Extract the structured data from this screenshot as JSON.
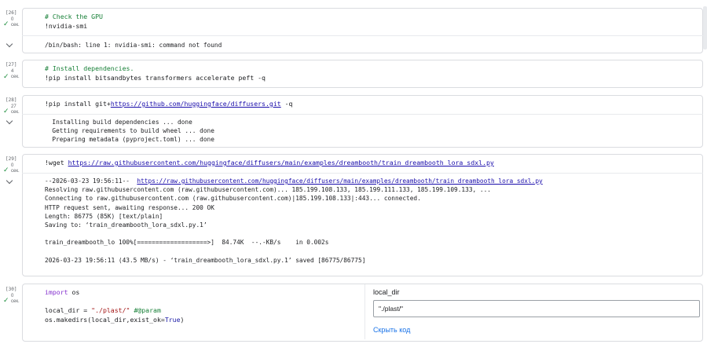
{
  "cells": [
    {
      "exec_count": "[26]",
      "duration": "0",
      "unit": "сек.",
      "code": [
        "# Check the GPU",
        "!nvidia-smi"
      ],
      "output": [
        "/bin/bash: line 1: nvidia-smi: command not found"
      ]
    },
    {
      "exec_count": "[27]",
      "duration": "4",
      "unit": "сек.",
      "code": [
        "# Install dependencies.",
        "!pip install bitsandbytes transformers accelerate peft -q"
      ]
    },
    {
      "exec_count": "[28]",
      "duration": "27",
      "unit": "сек.",
      "code_prefix": "!pip install git+",
      "code_link": "https://github.com/huggingface/diffusers.git",
      "code_suffix": " -q",
      "output": [
        "  Installing build dependencies ... done",
        "  Getting requirements to build wheel ... done",
        "  Preparing metadata (pyproject.toml) ... done"
      ]
    },
    {
      "exec_count": "[29]",
      "duration": "0",
      "unit": "сек.",
      "code_prefix": "!wget ",
      "code_link": "https://raw.githubusercontent.com/huggingface/diffusers/main/examples/dreambooth/train_dreambooth_lora_sdxl.py",
      "output_first_prefix": "--2026-03-23 19:56:11--  ",
      "output_first_link": "https://raw.githubusercontent.com/huggingface/diffusers/main/examples/dreambooth/train_dreambooth_lora_sdxl.py",
      "output": [
        "Resolving raw.githubusercontent.com (raw.githubusercontent.com)... 185.199.108.133, 185.199.111.133, 185.199.109.133, ...",
        "Connecting to raw.githubusercontent.com (raw.githubusercontent.com)|185.199.108.133|:443... connected.",
        "HTTP request sent, awaiting response... 200 OK",
        "Length: 86775 (85K) [text/plain]",
        "Saving to: ‘train_dreambooth_lora_sdxl.py.1’",
        "",
        "train_dreambooth_lo 100%[===================>]  84.74K  --.-KB/s    in 0.002s",
        "",
        "2026-03-23 19:56:11 (43.5 MB/s) - ‘train_dreambooth_lora_sdxl.py.1’ saved [86775/86775]"
      ]
    },
    {
      "exec_count": "[30]",
      "duration": "0",
      "unit": "сек.",
      "code_import_kw": "import",
      "code_import_mod": " os",
      "code_assign_var": "local_dir = ",
      "code_assign_str": "\"./plast/\"",
      "code_assign_cm": " #@param",
      "code_call": "os.makedirs(local_dir,exist_ok=",
      "code_call_kw": "True",
      "code_call_end": ")",
      "form": {
        "label": "local_dir",
        "value": "\"./plast/\"",
        "show_code": "Скрыть код"
      }
    }
  ]
}
